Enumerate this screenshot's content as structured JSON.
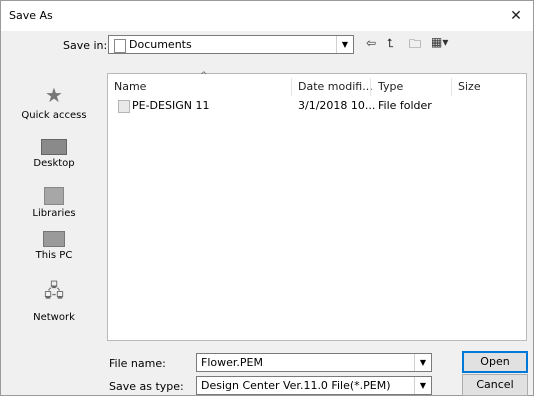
{
  "window": {
    "title": "Save As",
    "close_symbol": "✕"
  },
  "save_in": {
    "label": "Save in:",
    "value": "Documents"
  },
  "toolbar": {
    "back_icon": "back-arrow-icon",
    "up_icon": "up-folder-icon",
    "new_folder_icon": "new-folder-icon",
    "view_icon": "view-menu-icon"
  },
  "sidebar": {
    "items": [
      {
        "label": "Quick access",
        "icon": "star-icon"
      },
      {
        "label": "Desktop",
        "icon": "desktop-icon"
      },
      {
        "label": "Libraries",
        "icon": "libraries-icon"
      },
      {
        "label": "This PC",
        "icon": "computer-icon"
      },
      {
        "label": "Network",
        "icon": "network-icon"
      }
    ]
  },
  "file_list": {
    "columns": [
      "Name",
      "Date modifi...",
      "Type",
      "Size"
    ],
    "rows": [
      {
        "name": "PE-DESIGN 11",
        "date": "3/1/2018 10...",
        "type": "File folder",
        "size": ""
      }
    ]
  },
  "file_name": {
    "label": "File name:",
    "value": "Flower.PEM"
  },
  "save_as_type": {
    "label": "Save as type:",
    "value": "Design Center Ver.11.0 File(*.PEM)"
  },
  "buttons": {
    "open": "Open",
    "cancel": "Cancel"
  },
  "colors": {
    "accent": "#0078d7",
    "background": "#f0f0f0"
  }
}
